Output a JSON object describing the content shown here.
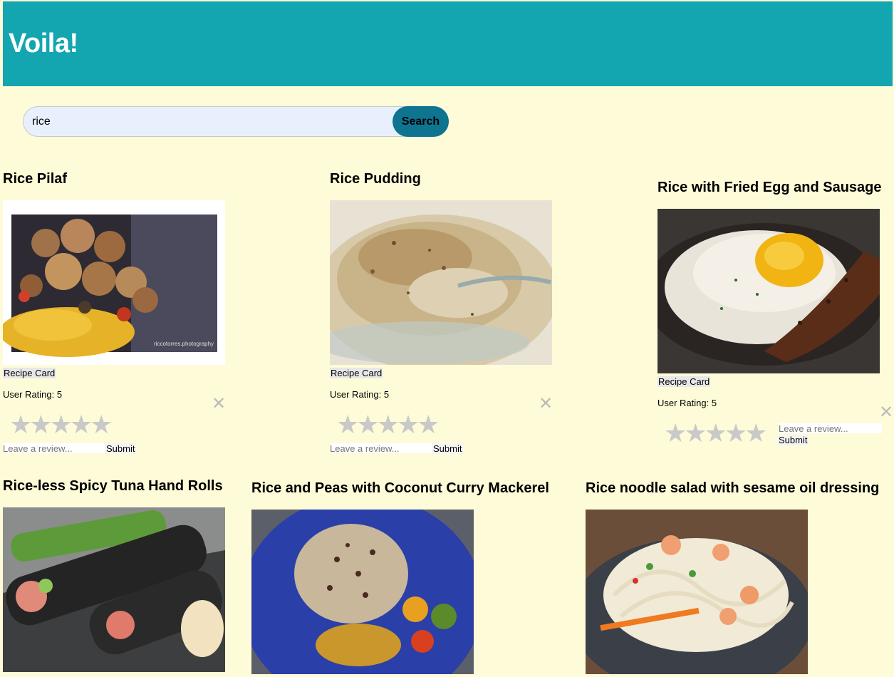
{
  "app": {
    "title": "Voila!"
  },
  "search": {
    "value": "rice",
    "button_label": "Search"
  },
  "cards": [
    {
      "title": "Rice Pilaf",
      "recipe_card_label": "Recipe Card",
      "rating_text": "User Rating: 5",
      "stars": 5,
      "review_placeholder": "Leave a review...",
      "submit_label": "Submit",
      "close_icon": "✕"
    },
    {
      "title": "Rice Pudding",
      "recipe_card_label": "Recipe Card",
      "rating_text": "User Rating: 5",
      "stars": 5,
      "review_placeholder": "Leave a review...",
      "submit_label": "Submit",
      "close_icon": "✕"
    },
    {
      "title": "Rice with Fried Egg and Sausage",
      "recipe_card_label": "Recipe Card",
      "rating_text": "User Rating: 5",
      "stars": 5,
      "review_placeholder": "Leave a review...",
      "submit_label": "Submit",
      "close_icon": "✕"
    },
    {
      "title": "Rice-less Spicy Tuna Hand Rolls"
    },
    {
      "title": "Rice and Peas with Coconut Curry Mackerel"
    },
    {
      "title": "Rice noodle salad with sesame oil dressing"
    }
  ],
  "icons": {
    "star": "star-icon",
    "close": "close-icon"
  },
  "colors": {
    "header": "#13a6b1",
    "background": "#fefbd8",
    "search_button": "#0e7490",
    "star": "#c9c9c9"
  }
}
